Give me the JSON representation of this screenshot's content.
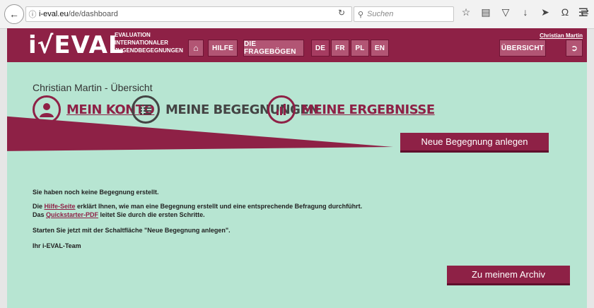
{
  "browser": {
    "url_domain": "i-eval.eu",
    "url_path": "/de/dashboard",
    "search_placeholder": "Suchen"
  },
  "header": {
    "logo_text": "i√EVAL",
    "logo_sub": [
      "EVALUATION",
      "INTERNATIONALER",
      "JUGENDBEGEGNUNGEN"
    ],
    "nav": {
      "hilfe": "HILFE",
      "frageboegen": "DIE FRAGEBÖGEN"
    },
    "languages": [
      "DE",
      "FR",
      "PL",
      "EN"
    ],
    "active_language": "DE",
    "user_name": "Christian Martin",
    "overview_button": "ÜBERSICHT"
  },
  "main": {
    "title": "Christian Martin - Übersicht",
    "tiles": {
      "konto": "MEIN KONTO",
      "begegnungen": "MEINE BEGEGNUNGEN",
      "ergebnisse": "MEINE ERGEBNISSE"
    },
    "new_button": "Neue Begegnung anlegen",
    "archive_button": "Zu meinem Archiv",
    "message": {
      "line1": "Sie haben noch keine Begegnung erstellt.",
      "line2_pre": "Die ",
      "line2_link": "Hilfe-Seite",
      "line2_post": " erklärt Ihnen, wie man eine Begegnung erstellt und eine entsprechende Befragung durchführt.",
      "line3_pre": "Das ",
      "line3_link": "Quickstarter-PDF",
      "line3_post": " leitet Sie durch die ersten Schritte.",
      "line4": "Starten Sie jetzt mit der Schaltfläche \"Neue Begegnung anlegen\".",
      "signature": "Ihr i-EVAL-Team"
    }
  },
  "colors": {
    "brand": "#8e2146",
    "background": "#b7e5d2"
  }
}
